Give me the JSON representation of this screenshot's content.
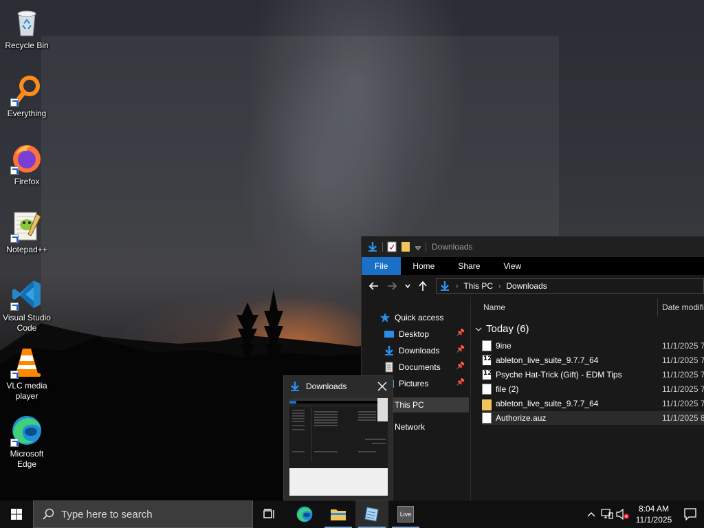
{
  "desktop": {
    "icons": [
      {
        "label": "Recycle Bin"
      },
      {
        "label": "Everything"
      },
      {
        "label": "Firefox"
      },
      {
        "label": "Notepad++"
      },
      {
        "label": "Visual Studio Code"
      },
      {
        "label": "VLC media player"
      },
      {
        "label": "Microsoft Edge"
      }
    ]
  },
  "explorer": {
    "title": "Downloads",
    "ribbon_tabs": [
      "File",
      "Home",
      "Share",
      "View"
    ],
    "breadcrumb": [
      "This PC",
      "Downloads"
    ],
    "nav": {
      "quick_access": "Quick access",
      "items": [
        {
          "label": "Desktop",
          "pinned": true
        },
        {
          "label": "Downloads",
          "pinned": true
        },
        {
          "label": "Documents",
          "pinned": true
        },
        {
          "label": "Pictures",
          "pinned": true
        }
      ],
      "this_pc": "This PC",
      "network": "Network"
    },
    "columns": {
      "name": "Name",
      "date": "Date modifi"
    },
    "group": "Today (6)",
    "files": [
      {
        "name": "9ine",
        "date": "11/1/2025 7",
        "icon": "document-icon"
      },
      {
        "name": "ableton_live_suite_9.7.7_64",
        "date": "11/1/2025 7",
        "icon": "ableton-live-icon"
      },
      {
        "name": "Psyche Hat-Trick (Gift) - EDM Tips",
        "date": "11/1/2025 7",
        "icon": "ableton-live-icon"
      },
      {
        "name": "file (2)",
        "date": "11/1/2025 7",
        "icon": "document-icon"
      },
      {
        "name": "ableton_live_suite_9.7.7_64",
        "date": "11/1/2025 7",
        "icon": "folder-icon"
      },
      {
        "name": "Authorize.auz",
        "date": "11/1/2025 8",
        "icon": "document-icon"
      }
    ]
  },
  "thumbnail": {
    "title": "Downloads"
  },
  "taskbar": {
    "search_placeholder": "Type here to search",
    "live_label": "Live",
    "time": "8:04 AM",
    "date": "11/1/2025"
  },
  "colors": {
    "accent": "#1a6fc7",
    "taskbar": "#101010",
    "explorer_bg": "#191919"
  }
}
